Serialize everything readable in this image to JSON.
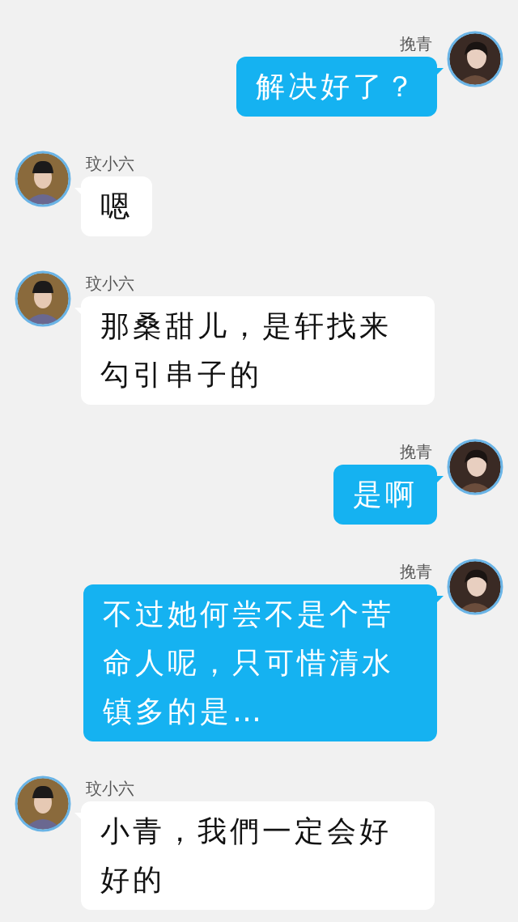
{
  "messages": [
    {
      "kind": "sent",
      "sender": "挽青",
      "text": "解决好了？"
    },
    {
      "kind": "received",
      "sender": "玟小六",
      "text": "嗯"
    },
    {
      "kind": "received",
      "sender": "玟小六",
      "text": "那桑甜儿，是轩找来勾引串子的"
    },
    {
      "kind": "sent",
      "sender": "挽青",
      "text": "是啊"
    },
    {
      "kind": "sent",
      "sender": "挽青",
      "text": "不过她何尝不是个苦命人呢，只可惜清水镇多的是…"
    },
    {
      "kind": "received",
      "sender": "玟小六",
      "text": "小青，我們一定会好好的"
    }
  ]
}
